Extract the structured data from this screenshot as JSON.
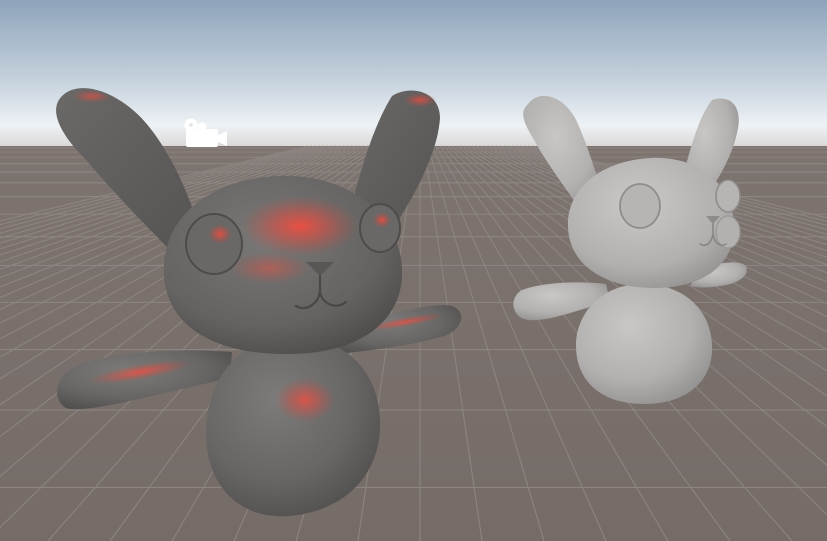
{
  "app": {
    "view": "Scene"
  },
  "viewport": {
    "sky_top_color": "#93a7bd",
    "horizon_color": "#e8eef3",
    "ground_color": "#7a716d",
    "grid_line_color": "#8e8682"
  },
  "objects": [
    {
      "name": "bunny-red-highlight",
      "body_color": "#6f6d6b",
      "highlight_color": "#ff4a3a",
      "selected": true
    },
    {
      "name": "bunny-plain",
      "body_color": "#b4b2b0",
      "selected": false
    }
  ],
  "gizmos": {
    "camera_icon": "camera-icon"
  }
}
